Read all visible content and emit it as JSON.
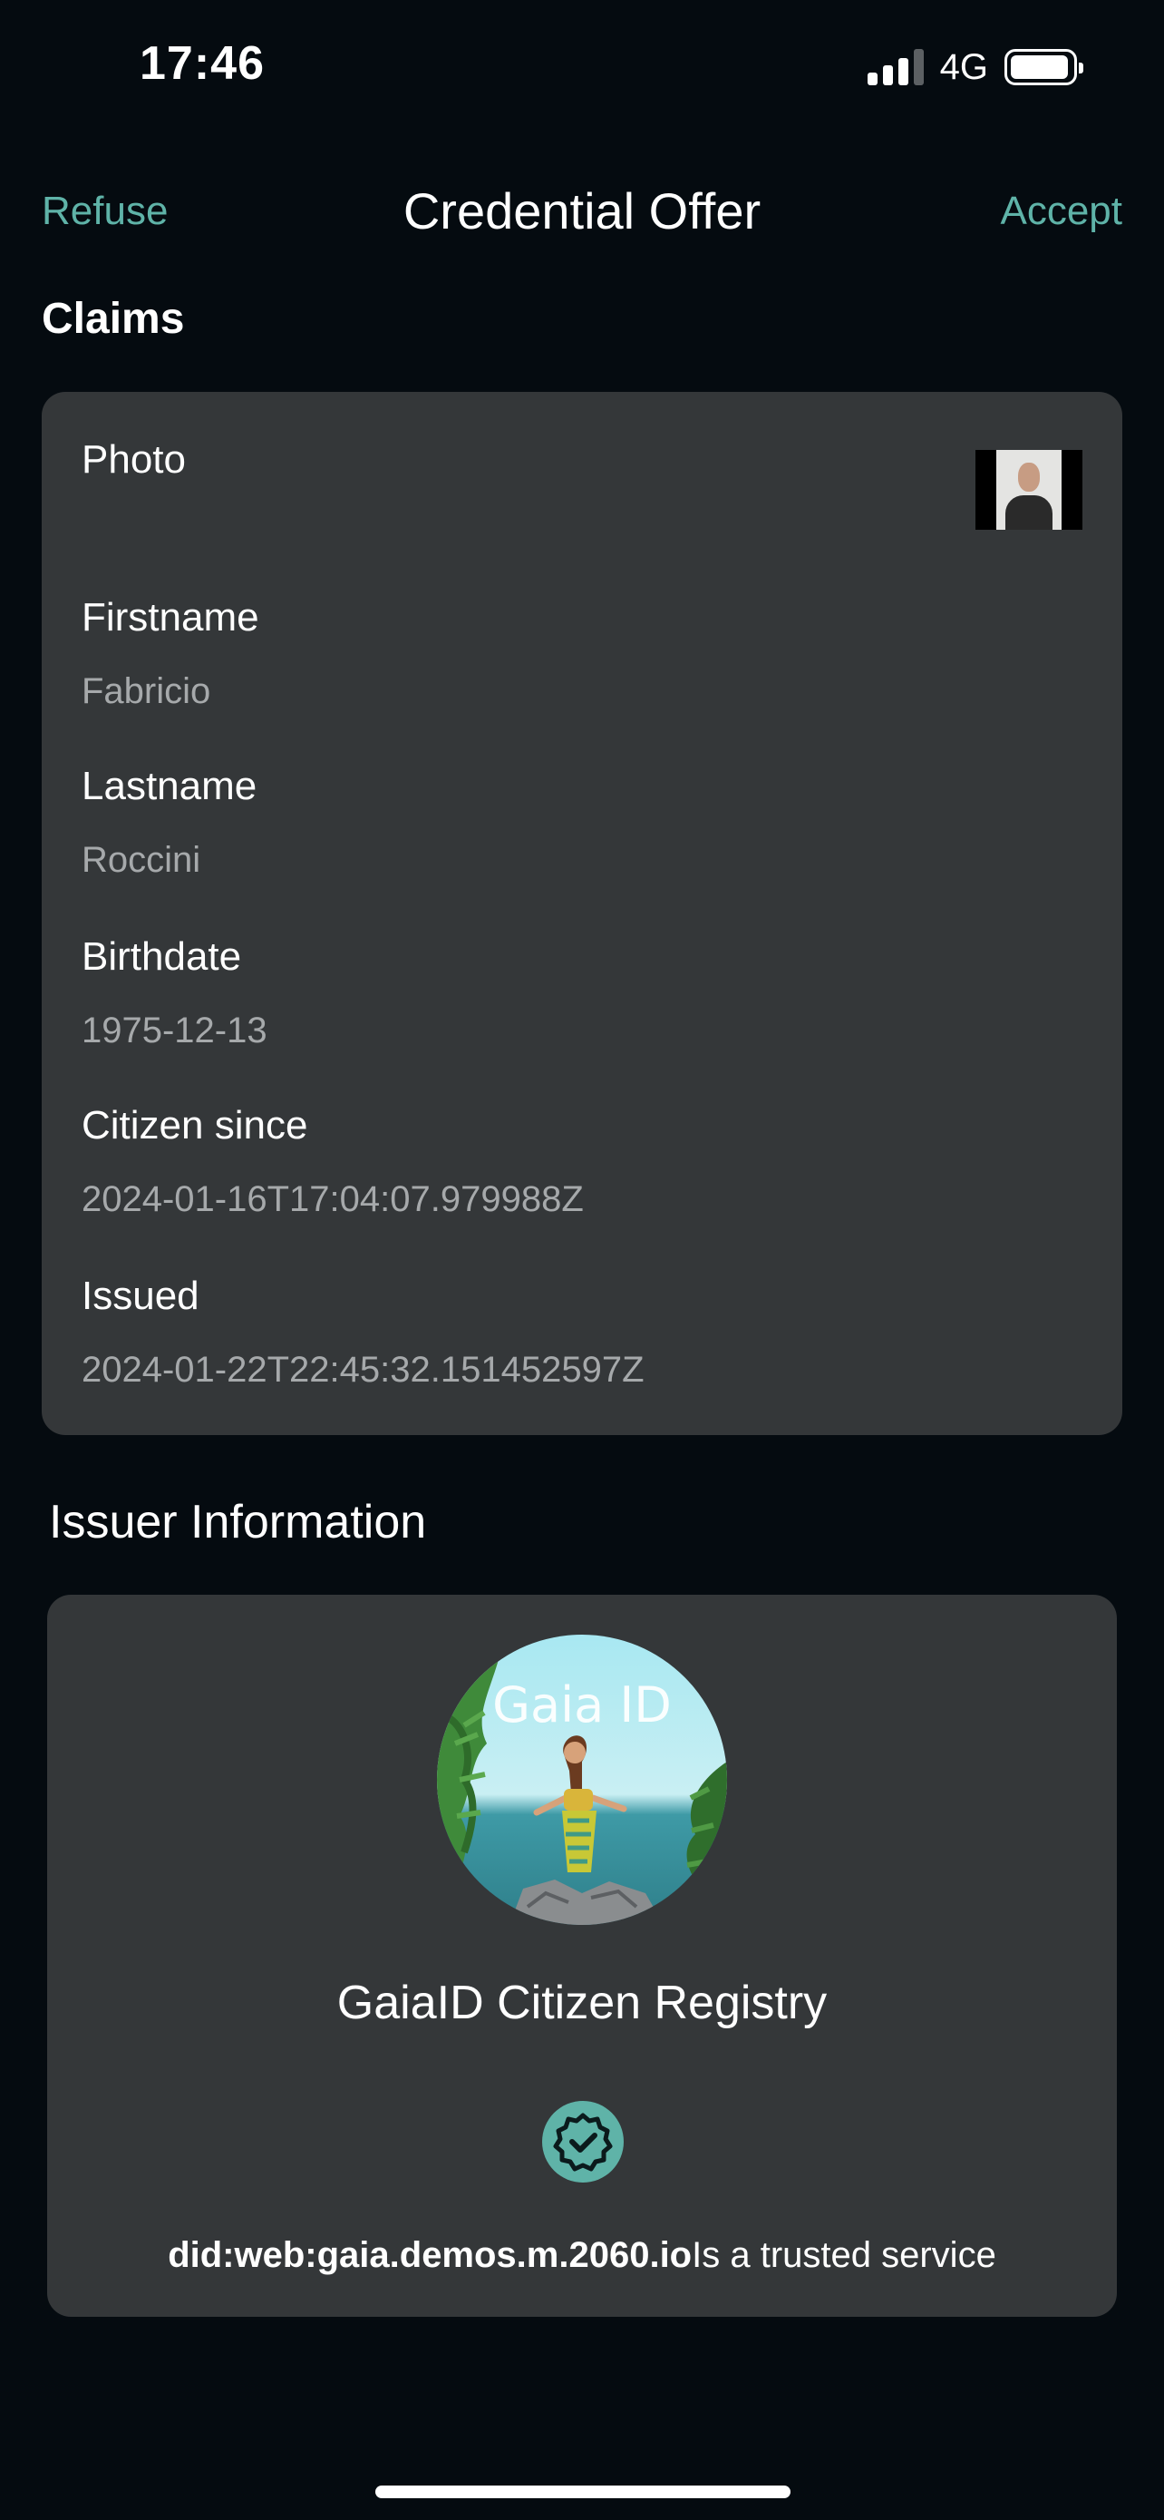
{
  "status_bar": {
    "time": "17:46",
    "network": "4G",
    "battery_level": 0.95
  },
  "nav": {
    "refuse_label": "Refuse",
    "title": "Credential Offer",
    "accept_label": "Accept"
  },
  "claims": {
    "title": "Claims",
    "photo_label": "Photo",
    "items": [
      {
        "label": "Firstname",
        "value": "Fabricio"
      },
      {
        "label": "Lastname",
        "value": "Roccini"
      },
      {
        "label": "Birthdate",
        "value": "1975-12-13"
      },
      {
        "label": "Citizen since",
        "value": "2024-01-16T17:04:07.979988Z"
      },
      {
        "label": "Issued",
        "value": "2024-01-22T22:45:32.151452597Z"
      }
    ]
  },
  "issuer": {
    "title": "Issuer Information",
    "logo_text": "Gaia ID",
    "name": "GaiaID Citizen Registry",
    "did": "did:web:gaia.demos.m.2060.io",
    "trusted_text": "Is a trusted service",
    "accent_color": "#5fb3a8"
  },
  "colors": {
    "background": "#050b10",
    "card": "#343739",
    "accent": "#5fb3a8"
  }
}
